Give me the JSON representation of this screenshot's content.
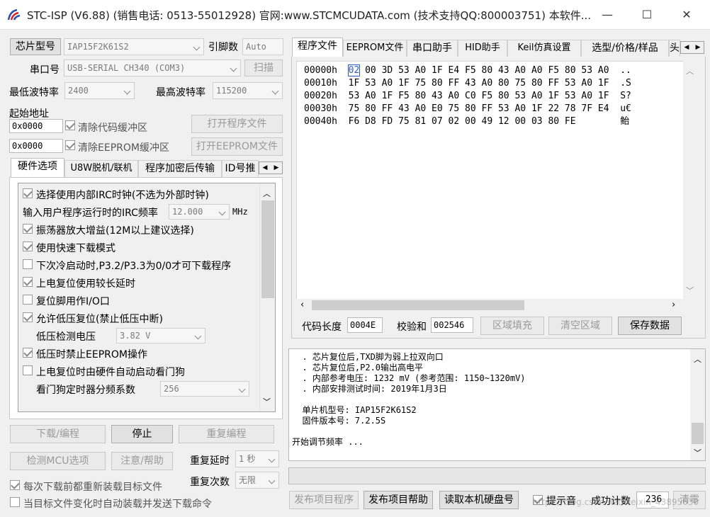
{
  "window": {
    "title": "STC-ISP (V6.88) (销售电话: 0513-55012928) 官网:www.STCMCUDATA.com  (技术支持QQ:800003751) 本软件...",
    "minimize": "—",
    "maximize": "☐",
    "close": "✕"
  },
  "chip": {
    "model_label": "芯片型号",
    "model_value": "IAP15F2K61S2",
    "pins_label": "引脚数",
    "pins_value": "Auto",
    "port_label": "串口号",
    "port_value": "USB-SERIAL CH340 (COM3)",
    "scan_button": "扫描",
    "min_baud_label": "最低波特率",
    "min_baud_value": "2400",
    "max_baud_label": "最高波特率",
    "max_baud_value": "115200",
    "start_addr_label": "起始地址",
    "code_addr": "0x0000",
    "clear_code_label": "清除代码缓冲区",
    "open_program_button": "打开程序文件",
    "eeprom_addr": "0x0000",
    "clear_eeprom_label": "清除EEPROM缓冲区",
    "open_eeprom_button": "打开EEPROM文件"
  },
  "left_tabs": [
    "硬件选项",
    "U8W脱机/联机",
    "程序加密后传输",
    "ID号推"
  ],
  "hw_options": {
    "opt_irc": "选择使用内部IRC时钟(不选为外部时钟)",
    "irc_freq_label": "输入用户程序运行时的IRC频率",
    "irc_freq_value": "12.000",
    "irc_freq_unit": "MHz",
    "opt_osc": "振荡器放大增益(12M以上建议选择)",
    "opt_fast": "使用快速下载模式",
    "opt_p32": "下次冷启动时,P3.2/P3.3为0/0才可下载程序",
    "opt_delay": "上电复位使用较长延时",
    "opt_resetio": "复位脚用作I/O口",
    "opt_lvr": "允许低压复位(禁止低压中断)",
    "lvd_label": "低压检测电压",
    "lvd_value": "3.82 V",
    "opt_lv_eeprom": "低压时禁止EEPROM操作",
    "opt_wdt": "上电复位时由硬件自动启动看门狗",
    "wdt_div_label": "看门狗定时器分频系数",
    "wdt_div_value": "256"
  },
  "actions": {
    "download": "下载/编程",
    "stop": "停止",
    "reprogram": "重复编程",
    "check_mcu": "检测MCU选项",
    "help": "注意/帮助",
    "repeat_delay_label": "重复延时",
    "repeat_delay_value": "1 秒",
    "repeat_count_label": "重复次数",
    "repeat_count_value": "无限",
    "reload_before": "每次下载前都重新装载目标文件",
    "auto_reload": "当目标文件变化时自动装载并发送下载命令"
  },
  "right_tabs": [
    "程序文件",
    "EEPROM文件",
    "串口助手",
    "HID助手",
    "Keil仿真设置",
    "选型/价格/样品",
    "头"
  ],
  "hex": {
    "rows": [
      {
        "addr": "00000h",
        "bytes": [
          "02",
          "00",
          "3D",
          "53",
          "A0",
          "1F",
          "E4",
          "F5",
          "80",
          "43",
          "A0",
          "A0",
          "F5",
          "80",
          "53",
          "A0"
        ],
        "ascii": ".."
      },
      {
        "addr": "00010h",
        "bytes": [
          "1F",
          "53",
          "A0",
          "1F",
          "75",
          "80",
          "FF",
          "43",
          "A0",
          "80",
          "75",
          "80",
          "FF",
          "53",
          "A0",
          "1F"
        ],
        "ascii": ".S"
      },
      {
        "addr": "00020h",
        "bytes": [
          "53",
          "A0",
          "1F",
          "F5",
          "80",
          "43",
          "A0",
          "C0",
          "F5",
          "80",
          "53",
          "A0",
          "1F",
          "53",
          "A0",
          "1F"
        ],
        "ascii": "S?"
      },
      {
        "addr": "00030h",
        "bytes": [
          "75",
          "80",
          "FF",
          "43",
          "A0",
          "E0",
          "75",
          "80",
          "FF",
          "53",
          "A0",
          "1F",
          "22",
          "78",
          "7F",
          "E4"
        ],
        "ascii": "u€"
      },
      {
        "addr": "00040h",
        "bytes": [
          "F6",
          "D8",
          "FD",
          "75",
          "81",
          "07",
          "02",
          "00",
          "49",
          "12",
          "00",
          "03",
          "80",
          "FE"
        ],
        "ascii": "鲐"
      }
    ],
    "code_len_label": "代码长度",
    "code_len_value": "0004E",
    "checksum_label": "校验和",
    "checksum_value": "002546",
    "fill_button": "区域填充",
    "clear_button": "清空区域",
    "save_button": "保存数据"
  },
  "log": {
    "lines": [
      "  . 芯片复位后,TXD脚为弱上拉双向口",
      "  . 芯片复位后,P2.0输出高电平",
      "  . 内部参考电压: 1232 mV (参考范围: 1150~1320mV)",
      "  . 内部安排测试时间: 2019年1月3日",
      "",
      "  单片机型号: IAP15F2K61S2",
      "  固件版本号: 7.2.5S",
      "",
      "开始调节频率 ..."
    ]
  },
  "bottom": {
    "publish_program": "发布项目程序",
    "publish_help": "发布项目帮助",
    "read_disk": "读取本机硬盘号",
    "beep_label": "提示音",
    "success_label": "成功计数",
    "success_value": "236",
    "clear_button": "清零",
    "watermark": "https://blog.csdn.net/weixin_43895630"
  }
}
